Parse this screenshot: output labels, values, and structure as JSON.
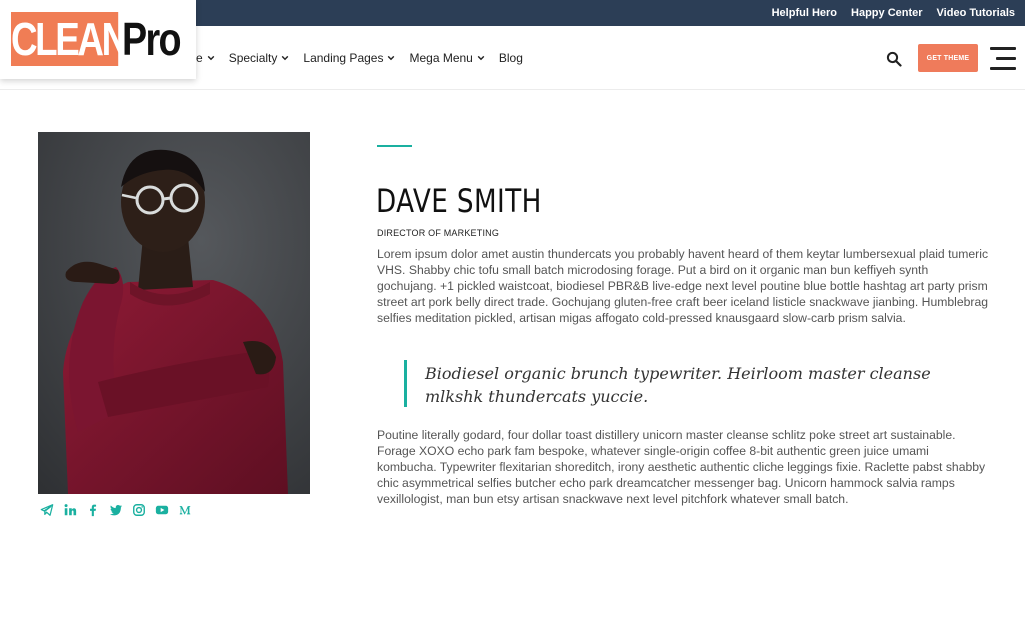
{
  "topbar": {
    "links": [
      "Helpful Hero",
      "Happy Center",
      "Video Tutorials"
    ]
  },
  "logo": {
    "part1": "CLEAN",
    "part2": "Pro"
  },
  "nav": {
    "items": [
      {
        "label": "e",
        "has_dropdown": true
      },
      {
        "label": "Specialty",
        "has_dropdown": true
      },
      {
        "label": "Landing Pages",
        "has_dropdown": true
      },
      {
        "label": "Mega Menu",
        "has_dropdown": true
      },
      {
        "label": "Blog",
        "has_dropdown": false
      }
    ],
    "cta_label": "GET THEME",
    "search_icon": "search-icon",
    "menu_icon": "hamburger-icon"
  },
  "profile": {
    "name": "DAVE SMITH",
    "role": "DIRECTOR OF MARKETING",
    "bio1": "Lorem ipsum dolor amet austin thundercats you probably havent heard of them keytar lumbersexual plaid tumeric VHS. Shabby chic tofu small batch microdosing forage. Put a bird on it organic man bun keffiyeh synth gochujang. +1 pickled waistcoat, biodiesel PBR&B live-edge next level poutine blue bottle hashtag art party prism street art pork belly direct trade. Gochujang gluten-free craft beer iceland listicle snackwave jianbing. Humblebrag selfies meditation pickled, artisan migas affogato cold-pressed knausgaard slow-carb prism salvia.",
    "quote": "Biodiesel organic brunch typewriter. Heirloom master cleanse mlkshk thundercats yuccie.",
    "bio2": "Poutine literally godard, four dollar toast distillery unicorn master cleanse schlitz poke street art sustainable. Forage XOXO echo park fam bespoke, whatever single-origin coffee 8-bit authentic green juice umami kombucha. Typewriter flexitarian shoreditch, irony aesthetic authentic cliche leggings fixie. Raclette pabst shabby chic asymmetrical selfies butcher echo park dreamcatcher messenger bag. Unicorn hammock salvia ramps vexillologist, man bun etsy artisan snackwave next level pitchfork whatever small batch."
  },
  "social": [
    "telegram-icon",
    "linkedin-icon",
    "facebook-icon",
    "twitter-icon",
    "instagram-icon",
    "youtube-icon",
    "medium-icon"
  ],
  "colors": {
    "topbar_bg": "#2c3e56",
    "accent": "#1ab0a0",
    "cta_bg": "#ef7b5b",
    "logo_orange": "#f07d55"
  }
}
